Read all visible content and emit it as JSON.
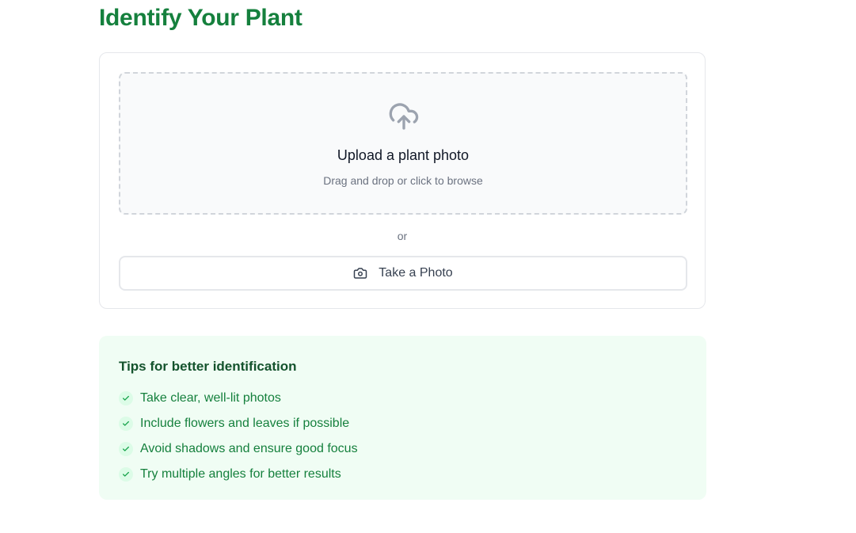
{
  "page": {
    "title": "Identify Your Plant"
  },
  "upload": {
    "dropzone_title": "Upload a plant photo",
    "dropzone_subtitle": "Drag and drop or click to browse",
    "icon": "cloud-upload-icon",
    "divider_text": "or",
    "take_photo_label": "Take a Photo",
    "take_photo_icon": "camera-icon"
  },
  "tips": {
    "title": "Tips for better identification",
    "items": [
      "Take clear, well-lit photos",
      "Include flowers and leaves if possible",
      "Avoid shadows and ensure good focus",
      "Try multiple angles for better results"
    ]
  },
  "colors": {
    "brand_green": "#15803d",
    "tips_background": "#f0fdf4",
    "tips_title": "#14532d",
    "check_background": "#dcfce7"
  }
}
